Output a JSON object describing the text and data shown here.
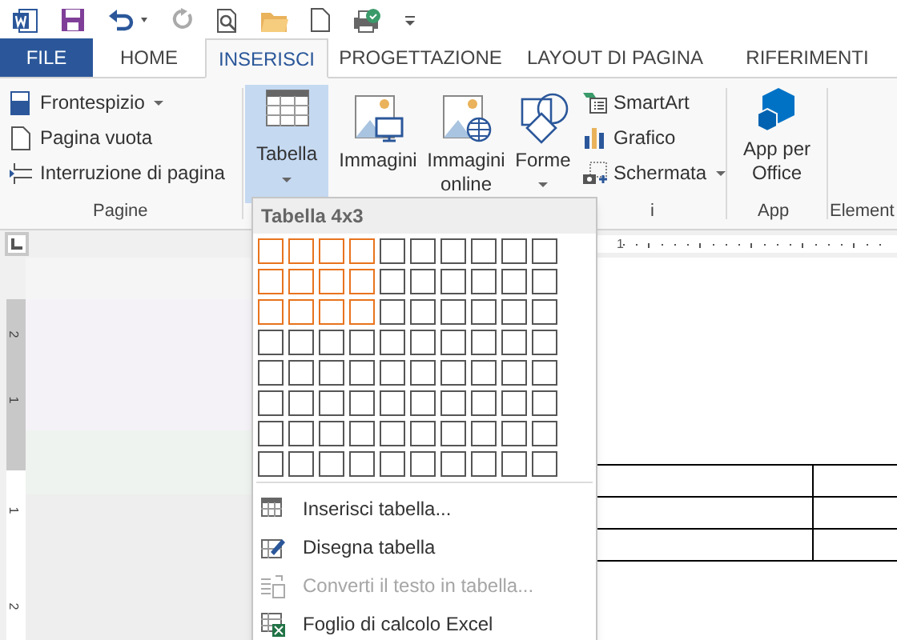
{
  "tabs": [
    {
      "label": "FILE",
      "kind": "file",
      "selected": false
    },
    {
      "label": "HOME",
      "kind": "tab",
      "selected": false
    },
    {
      "label": "INSERISCI",
      "kind": "tab",
      "selected": true
    },
    {
      "label": "PROGETTAZIONE",
      "kind": "tab",
      "selected": false
    },
    {
      "label": "LAYOUT DI PAGINA",
      "kind": "tab",
      "selected": false
    },
    {
      "label": "RIFERIMENTI",
      "kind": "tab",
      "selected": false
    }
  ],
  "ribbon": {
    "pagine": {
      "items": [
        {
          "label": "Frontespizio",
          "kind": "cover",
          "dropdown": true
        },
        {
          "label": "Pagina vuota",
          "kind": "blank",
          "dropdown": false
        },
        {
          "label": "Interruzione di pagina",
          "kind": "break",
          "dropdown": false
        }
      ],
      "group_label": "Pagine"
    },
    "tabella_button": {
      "label": "Tabella",
      "expanded": true
    },
    "illustrations": {
      "large": [
        {
          "label": "Immagini",
          "kind": "picture"
        },
        {
          "label": "Immagini online",
          "kind": "online"
        },
        {
          "label": "Forme",
          "kind": "shapes"
        }
      ],
      "small": [
        {
          "label": "SmartArt",
          "kind": "smartart",
          "dropdown": false
        },
        {
          "label": "Grafico",
          "kind": "chart",
          "dropdown": false
        },
        {
          "label": "Schermata",
          "kind": "screenshot",
          "dropdown": true
        }
      ],
      "group_label": "i"
    },
    "app": {
      "label": "App per Office",
      "group_label": "App"
    },
    "next_group_label": "Element"
  },
  "horizontal_ruler": {
    "labels": [
      "1"
    ]
  },
  "vertical_ruler": {
    "labels": [
      "2",
      "1",
      "1",
      "2"
    ]
  },
  "table_menu": {
    "title": "Tabella 4x3",
    "grid": [
      [
        true,
        true,
        true,
        true,
        false,
        false,
        false,
        false,
        false,
        false
      ],
      [
        true,
        true,
        true,
        true,
        false,
        false,
        false,
        false,
        false,
        false
      ],
      [
        true,
        true,
        true,
        true,
        false,
        false,
        false,
        false,
        false,
        false
      ],
      [
        false,
        false,
        false,
        false,
        false,
        false,
        false,
        false,
        false,
        false
      ],
      [
        false,
        false,
        false,
        false,
        false,
        false,
        false,
        false,
        false,
        false
      ],
      [
        false,
        false,
        false,
        false,
        false,
        false,
        false,
        false,
        false,
        false
      ],
      [
        false,
        false,
        false,
        false,
        false,
        false,
        false,
        false,
        false,
        false
      ],
      [
        false,
        false,
        false,
        false,
        false,
        false,
        false,
        false,
        false,
        false
      ]
    ],
    "items": [
      {
        "label": "Inserisci tabella...",
        "kind": "insert",
        "disabled": false
      },
      {
        "label": "Disegna tabella",
        "kind": "draw",
        "disabled": false
      },
      {
        "label": "Converti il testo in tabella...",
        "kind": "convert",
        "disabled": true
      },
      {
        "label": "Foglio di calcolo Excel",
        "kind": "excel",
        "disabled": false
      }
    ]
  }
}
